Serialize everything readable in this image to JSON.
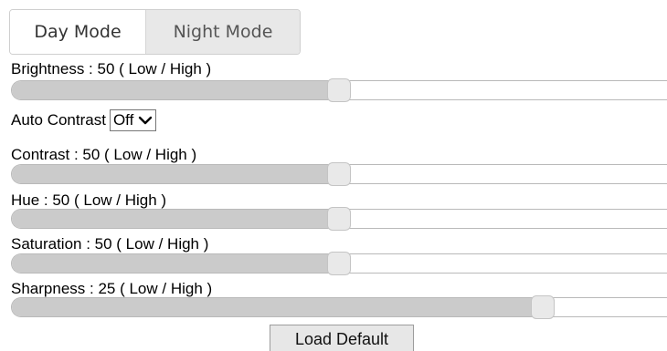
{
  "modes": {
    "day_label": "Day Mode",
    "night_label": "Night Mode",
    "selected": "Day Mode"
  },
  "sliders": {
    "brightness": {
      "label": "Brightness : 50 ( Low / High )",
      "value": 50,
      "fraction": 0.5
    },
    "contrast": {
      "label": "Contrast : 50 ( Low / High )",
      "value": 50,
      "fraction": 0.5
    },
    "hue": {
      "label": "Hue : 50 ( Low / High )",
      "value": 50,
      "fraction": 0.5
    },
    "saturation": {
      "label": "Saturation : 50 ( Low / High )",
      "value": 50,
      "fraction": 0.5
    },
    "sharpness": {
      "label": "Sharpness : 25 ( Low / High )",
      "value": 25,
      "fraction": 0.81
    }
  },
  "auto_contrast": {
    "label": "Auto Contrast",
    "value": "Off"
  },
  "actions": {
    "load_default_label": "Load Default"
  },
  "colors": {
    "fill": "#cbcbcb",
    "thumb": "#e9e9e9",
    "inactive_tab": "#e8e8e8"
  },
  "icons": {
    "select_arrow": "chevron-down-icon"
  }
}
